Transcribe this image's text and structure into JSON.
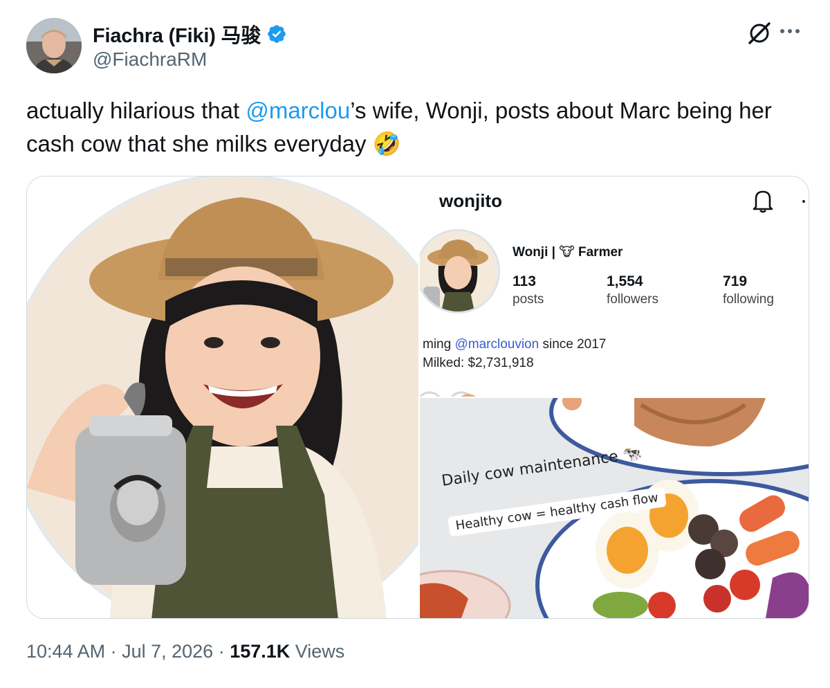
{
  "author": {
    "display_name": "Fiachra (Fiki) 马骏",
    "handle": "@FiachraRM",
    "avatar_icon": "user-photo-avatar",
    "verified": true
  },
  "tweet": {
    "text_before": "actually hilarious that ",
    "mention": "@marclou",
    "text_after": "’s wife, Wonji, posts about Marc being her cash cow that she milks everyday 🤣"
  },
  "instagram_panel": {
    "username": "wonjito",
    "name_line": "Wonji | 🐮 Farmer",
    "stats": [
      {
        "value": "113",
        "label": "posts"
      },
      {
        "value": "1,554",
        "label": "followers"
      },
      {
        "value": "719",
        "label": "following"
      }
    ],
    "bio_prefix": "ming ",
    "bio_link": "@marclouvion",
    "bio_suffix": " since 2017",
    "bio_line2": "Milked: $2,731,918"
  },
  "food_panel": {
    "caption_title": "Daily cow maintenance 🐄",
    "caption_sub": "Healthy cow = healthy cash flow"
  },
  "meta": {
    "time": "10:44 AM",
    "sep1": " · ",
    "date": "Jul 7, 2026",
    "sep2": " · ",
    "views_count": "157.1K",
    "views_label": " Views"
  },
  "colors": {
    "accent": "#1d9bf0",
    "secondary_text": "#536471",
    "border": "#cfd9de"
  }
}
